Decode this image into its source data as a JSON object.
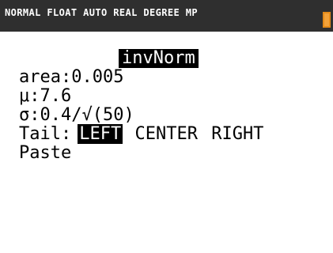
{
  "status_bar": {
    "text": "NORMAL FLOAT AUTO REAL DEGREE MP",
    "battery_color": "#f2a23a"
  },
  "menu": {
    "title": "invNorm"
  },
  "fields": {
    "area": {
      "label": "area:",
      "value": "0.005"
    },
    "mu": {
      "label": "μ:",
      "value": "7.6"
    },
    "sigma": {
      "label": "σ:",
      "value": "0.4/√(50)"
    }
  },
  "tail": {
    "label": "Tail:",
    "options": [
      "LEFT",
      "CENTER",
      "RIGHT"
    ],
    "selected": "LEFT"
  },
  "paste": {
    "label": "Paste"
  }
}
